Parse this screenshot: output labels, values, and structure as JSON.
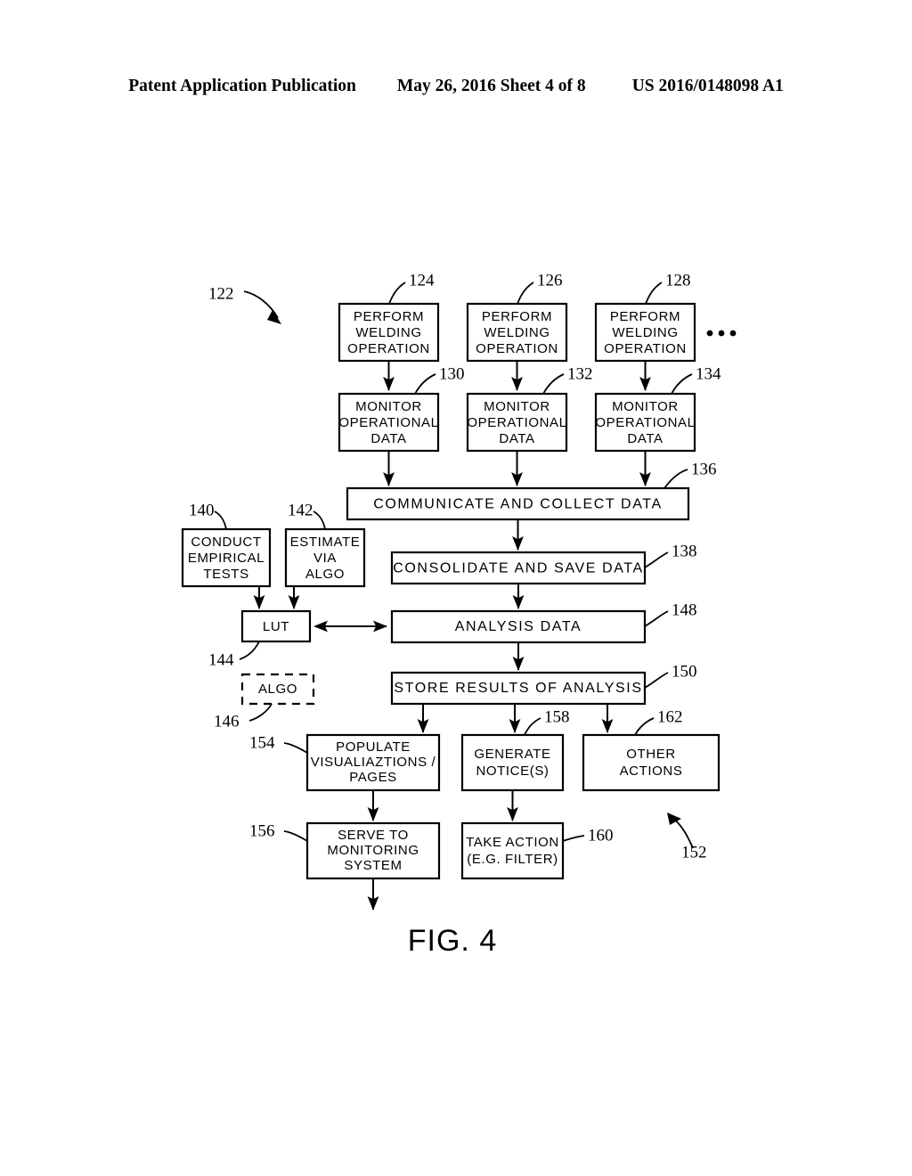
{
  "header": {
    "title": "Patent Application Publication",
    "date_sheet": "May 26, 2016  Sheet 4 of 8",
    "patent_number": "US 2016/0148098 A1"
  },
  "figure": {
    "caption": "FIG. 4",
    "overall_ref": "122",
    "actions_group_ref": "152",
    "ellipsis": "• • •"
  },
  "nodes": [
    {
      "id": "perform-welding-1",
      "ref": "124",
      "lines": [
        "PERFORM",
        "WELDING",
        "OPERATION"
      ]
    },
    {
      "id": "perform-welding-2",
      "ref": "126",
      "lines": [
        "PERFORM",
        "WELDING",
        "OPERATION"
      ]
    },
    {
      "id": "perform-welding-3",
      "ref": "128",
      "lines": [
        "PERFORM",
        "WELDING",
        "OPERATION"
      ]
    },
    {
      "id": "monitor-operational-data-1",
      "ref": "130",
      "lines": [
        "MONITOR",
        "OPERATIONAL",
        "DATA"
      ]
    },
    {
      "id": "monitor-operational-data-2",
      "ref": "132",
      "lines": [
        "MONITOR",
        "OPERATIONAL",
        "DATA"
      ]
    },
    {
      "id": "monitor-operational-data-3",
      "ref": "134",
      "lines": [
        "MONITOR",
        "OPERATIONAL",
        "DATA"
      ]
    },
    {
      "id": "communicate-and-collect-data",
      "ref": "136",
      "lines": [
        "COMMUNICATE  AND  COLLECT  DATA"
      ]
    },
    {
      "id": "consolidate-and-save-data",
      "ref": "138",
      "lines": [
        "CONSOLIDATE  AND  SAVE  DATA"
      ]
    },
    {
      "id": "conduct-empirical-tests",
      "ref": "140",
      "lines": [
        "CONDUCT",
        "EMPIRICAL",
        "TESTS"
      ]
    },
    {
      "id": "estimate-via-algo",
      "ref": "142",
      "lines": [
        "ESTIMATE",
        "VIA",
        "ALGO"
      ]
    },
    {
      "id": "lut",
      "ref": "144",
      "lines": [
        "LUT"
      ]
    },
    {
      "id": "algo",
      "ref": "146",
      "lines": [
        "ALGO"
      ]
    },
    {
      "id": "analysis-data",
      "ref": "148",
      "lines": [
        "ANALYSIS  DATA"
      ]
    },
    {
      "id": "store-results-of-analysis",
      "ref": "150",
      "lines": [
        "STORE  RESULTS  OF  ANALYSIS"
      ]
    },
    {
      "id": "populate-visualizations-pages",
      "ref": "154",
      "lines": [
        "POPULATE",
        "VISUALIAZTIONS /",
        "PAGES"
      ]
    },
    {
      "id": "serve-to-monitoring-system",
      "ref": "156",
      "lines": [
        "SERVE  TO",
        "MONITORING",
        "SYSTEM"
      ]
    },
    {
      "id": "generate-notices",
      "ref": "158",
      "lines": [
        "GENERATE",
        "NOTICE(S)"
      ]
    },
    {
      "id": "take-action-filter",
      "ref": "160",
      "lines": [
        "TAKE  ACTION",
        "(E.G. FILTER)"
      ]
    },
    {
      "id": "other-actions",
      "ref": "162",
      "lines": [
        "OTHER",
        "ACTIONS"
      ]
    }
  ],
  "colors": {
    "ink": "#000000",
    "paper": "#ffffff"
  }
}
